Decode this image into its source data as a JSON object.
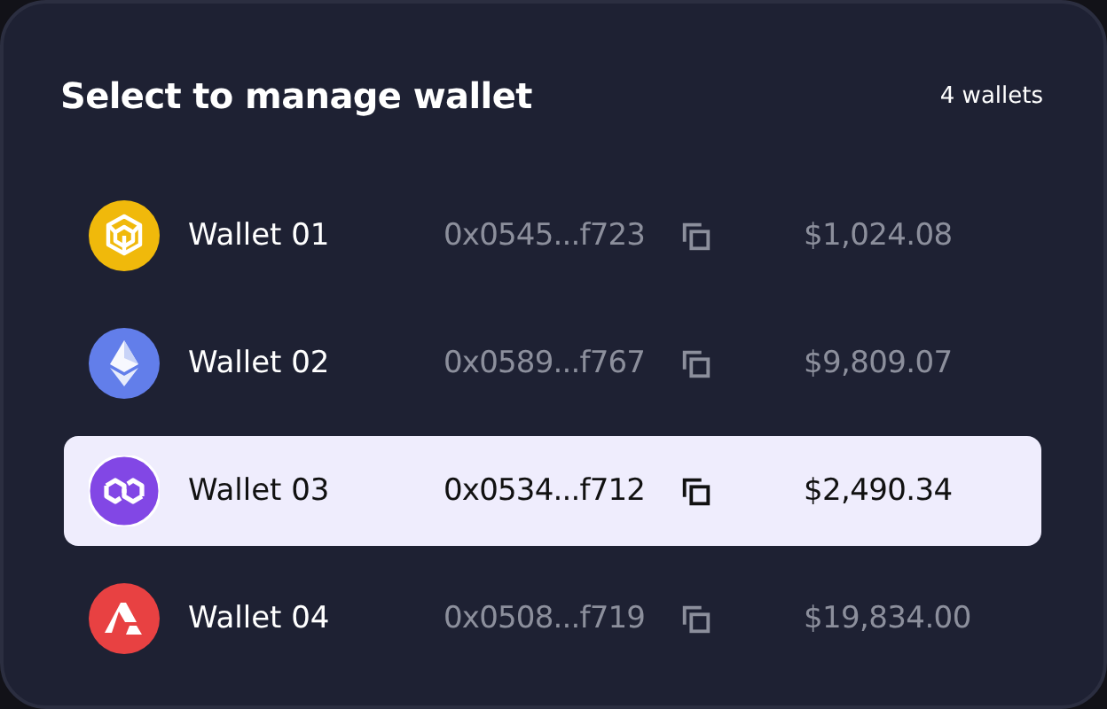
{
  "title": "Select to manage wallet",
  "count": "4 wallets",
  "wallets": [
    {
      "kind": "bnb",
      "name": "Wallet 01",
      "address": "0x0545...f723",
      "balance": "$1,024.08",
      "selected": false
    },
    {
      "kind": "eth",
      "name": "Wallet 02",
      "address": "0x0589...f767",
      "balance": "$9,809.07",
      "selected": false
    },
    {
      "kind": "polygon",
      "name": "Wallet 03",
      "address": "0x0534...f712",
      "balance": "$2,490.34",
      "selected": true
    },
    {
      "kind": "avax",
      "name": "Wallet 04",
      "address": "0x0508...f719",
      "balance": "$19,834.00",
      "selected": false
    }
  ]
}
